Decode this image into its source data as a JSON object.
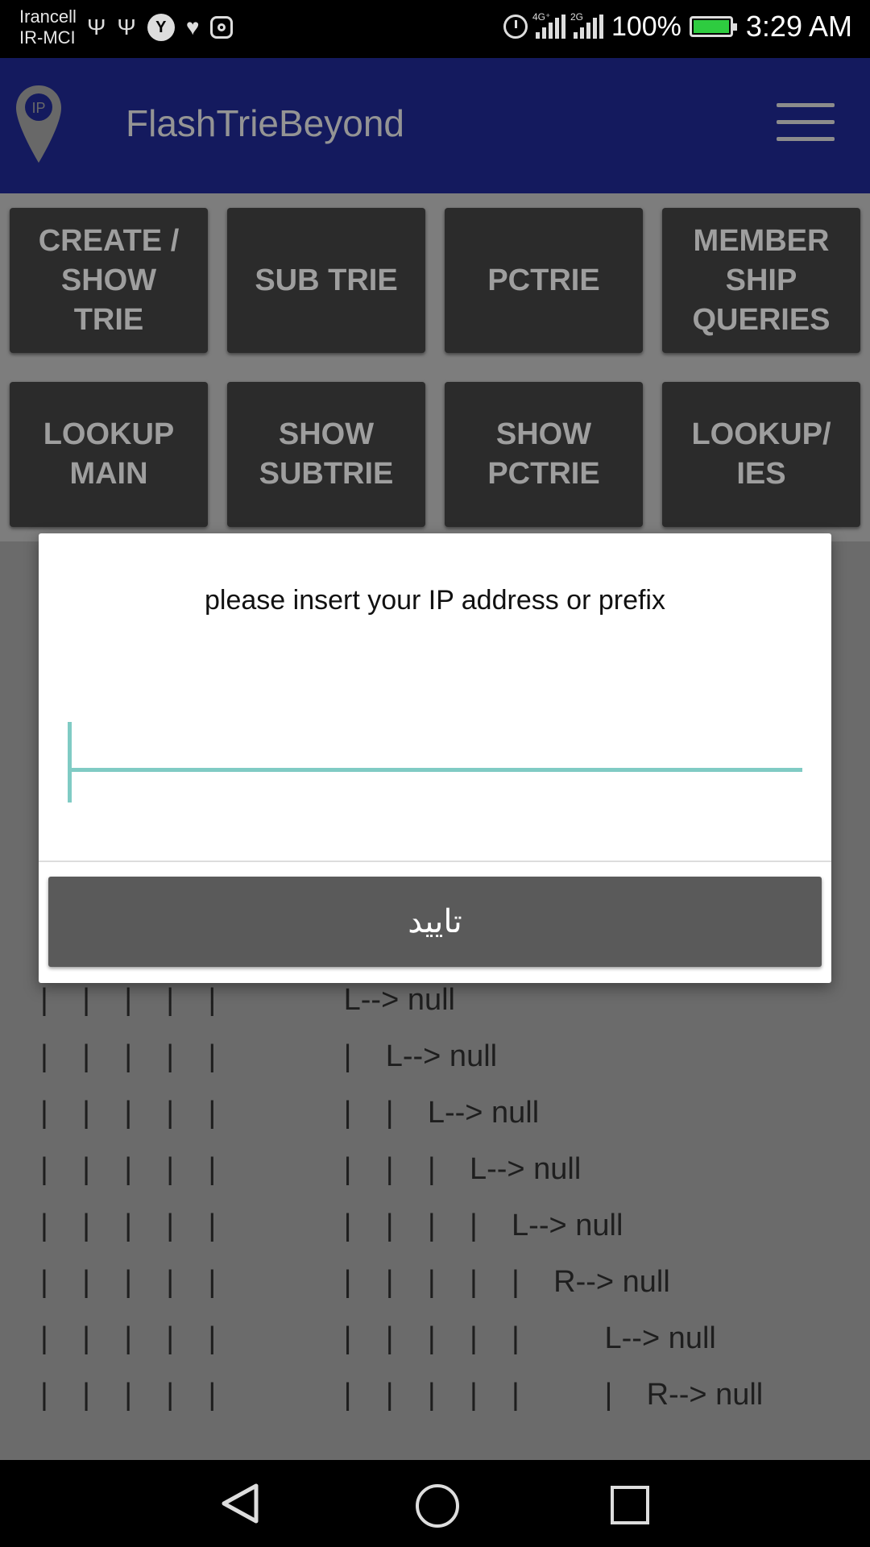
{
  "status_bar": {
    "carrier_line1": "Irancell",
    "carrier_line2": "IR-MCI",
    "network_1": "4G⁺",
    "network_2": "2G",
    "battery": "100%",
    "time": "3:29 AM"
  },
  "app_bar": {
    "title": "FlashTrieBeyond",
    "logo_text": "IP"
  },
  "buttons": [
    {
      "label": "CREATE /\nSHOW\nTRIE"
    },
    {
      "label": "SUB TRIE"
    },
    {
      "label": "PCTRIE"
    },
    {
      "label": "MEMBER\nSHIP\nQUERIES"
    },
    {
      "label": "LOOKUP\nMAIN"
    },
    {
      "label": "SHOW\nSUBTRIE"
    },
    {
      "label": "SHOW\nPCTRIE"
    },
    {
      "label": "LOOKUP/\nIES"
    }
  ],
  "tree_lines": [
    "|    |    |    |    |               L--> null",
    "|    |    |    |    |               |    L--> null",
    "|    |    |    |    |               |    |    L--> null",
    "|    |    |    |    |               |    |    |    L--> null",
    "|    |    |    |    |               |    |    |    |    L--> null",
    "|    |    |    |    |               |    |    |    |    |    R--> null",
    "|    |    |    |    |               |    |    |    |    |          L--> null",
    "|    |    |    |    |               |    |    |    |    |          |    R--> null"
  ],
  "dialog": {
    "message": "please insert your IP address or prefix",
    "input_value": "",
    "confirm_label": "تایید"
  },
  "colors": {
    "app_bar": "#1a237e",
    "accent": "#80cbc4",
    "button_bg": "#2b2b2b"
  }
}
